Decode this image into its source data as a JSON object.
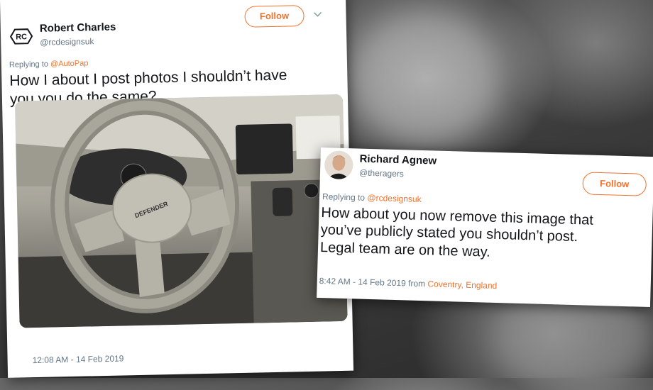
{
  "tweet1": {
    "author_name": "Robert Charles",
    "author_handle": "@rcdesignsuk",
    "logo_text": "RC",
    "follow_label": "Follow",
    "replying_prefix": "Replying to",
    "replying_mention": "@AutoPap",
    "text_line1": "How I about I post photos I shouldn’t have",
    "text_line2": "you you do the same?",
    "photo_badge_text": "DEFENDER",
    "timestamp": "12:08 AM - 14 Feb 2019"
  },
  "tweet2": {
    "author_name": "Richard Agnew",
    "author_handle": "@theragers",
    "follow_label": "Follow",
    "replying_prefix": "Replying to",
    "replying_mention": "@rcdesignsuk",
    "text_line1": "How about you now remove this image that",
    "text_line2": "you’ve publicly stated you shouldn’t post.",
    "text_line3": "Legal team are on the way.",
    "timestamp": "8:42 AM - 14 Feb 2019",
    "from_label": "from",
    "location": "Coventry, England"
  },
  "colors": {
    "accent": "#f0722d",
    "text": "#14171a",
    "muted": "#657786"
  },
  "icons": {
    "tweet1_menu": "chevron-down-icon"
  }
}
